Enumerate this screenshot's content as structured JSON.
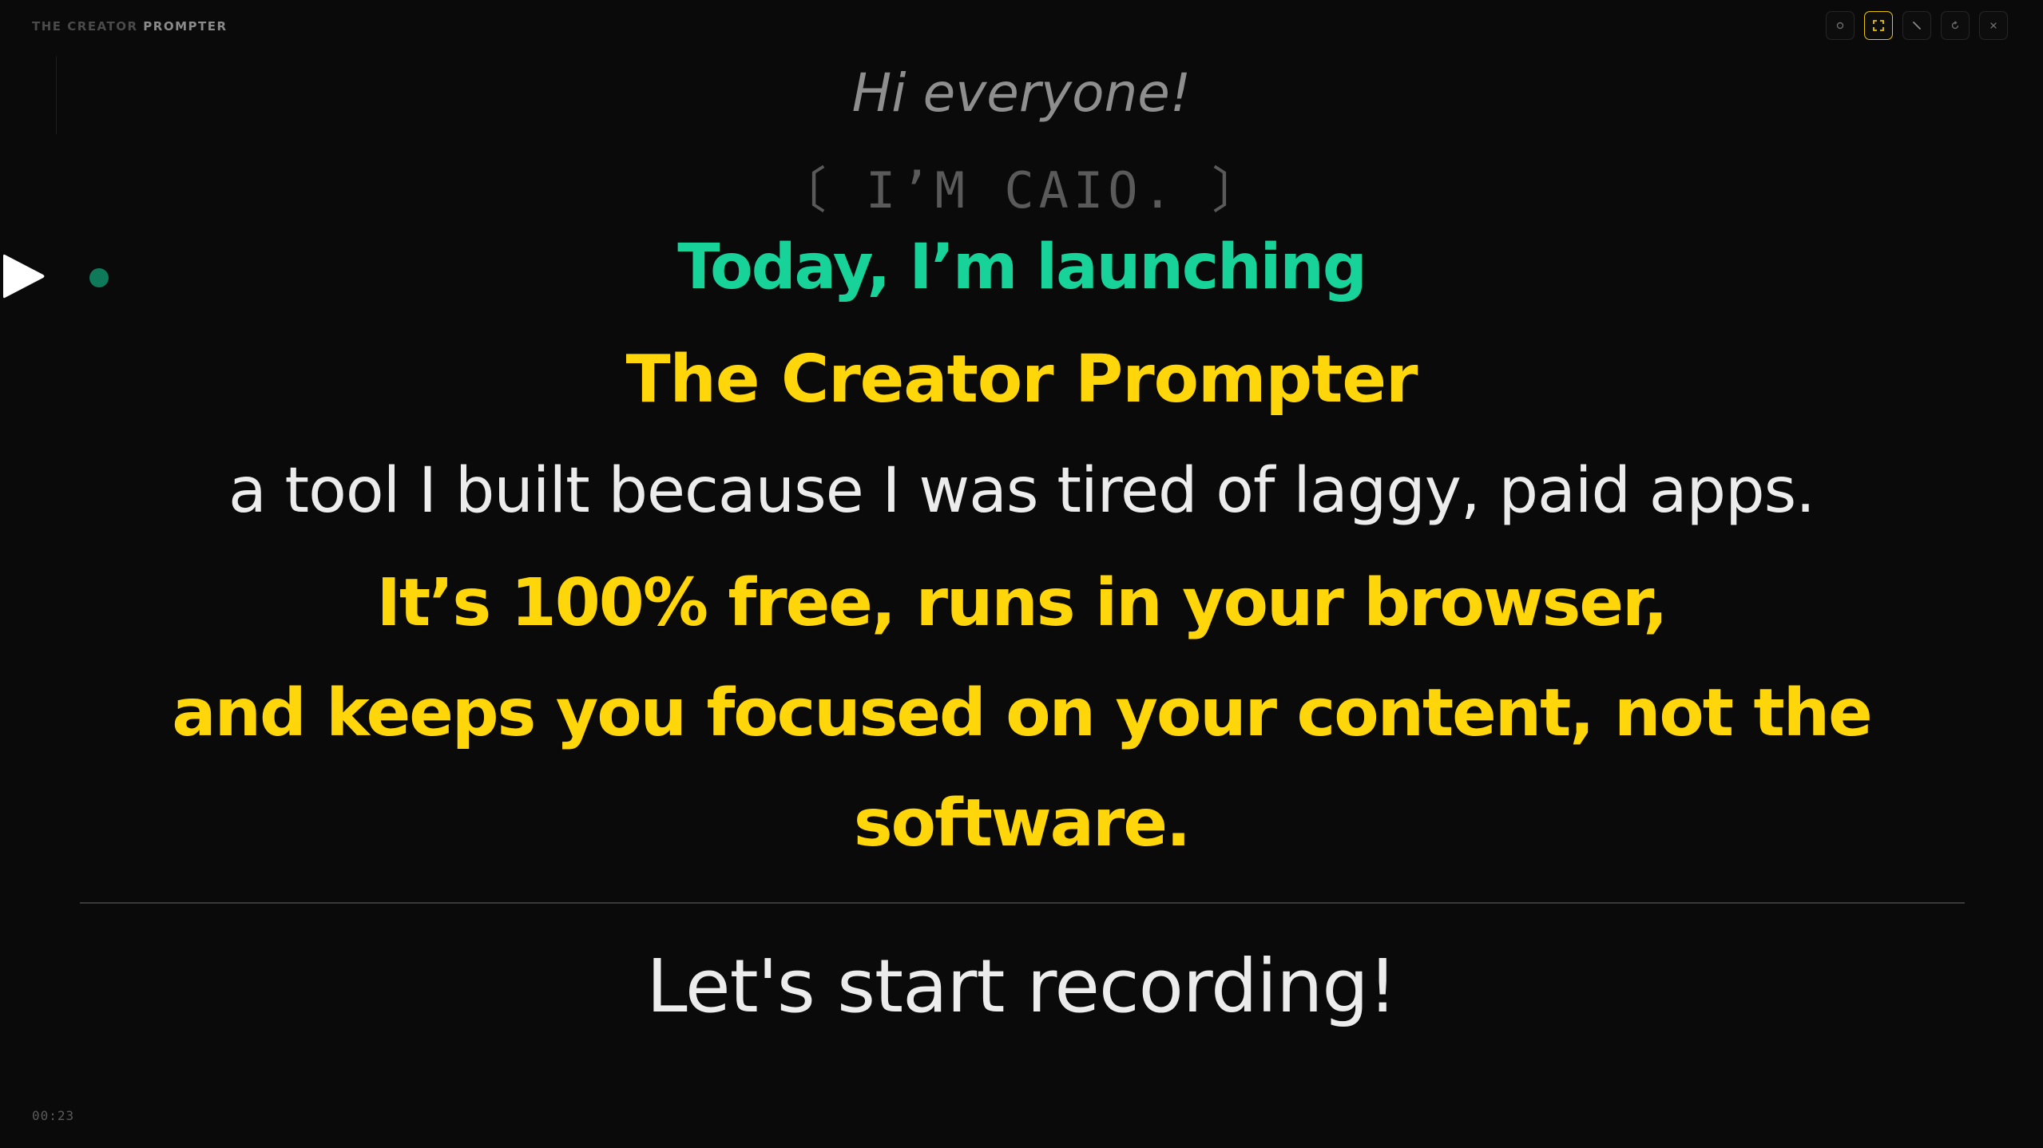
{
  "header": {
    "brand_prefix": "THE CREATOR",
    "brand_suffix": "PROMPTER"
  },
  "toolbar": {
    "buttons": [
      {
        "icon": "circle-icon",
        "active": false
      },
      {
        "icon": "focus-frame-icon",
        "active": true
      },
      {
        "icon": "slash-icon",
        "active": false
      },
      {
        "icon": "reset-icon",
        "active": false
      },
      {
        "icon": "close-icon",
        "active": false
      }
    ]
  },
  "player": {
    "play_icon": "play-icon",
    "status": "recording-indicator",
    "status_color": "#0f7a5a"
  },
  "script": {
    "greeting": "Hi everyone!",
    "intro": "〔 I’M CAIO. 〕",
    "launch": "Today, I’m launching",
    "product": "The Creator Prompter",
    "tool": "a tool I built because I was tired of laggy, paid apps.",
    "free": "It’s 100% free, runs in your browser,",
    "focus": "and keeps you focused on your content, not the",
    "software": "software.",
    "record": "Let's start recording!"
  },
  "footer": {
    "timer": "00:23"
  },
  "colors": {
    "background": "#0a0a0a",
    "highlight_yellow": "#ffd60a",
    "highlight_green": "#17d39a",
    "active_border": "#e9c400"
  }
}
